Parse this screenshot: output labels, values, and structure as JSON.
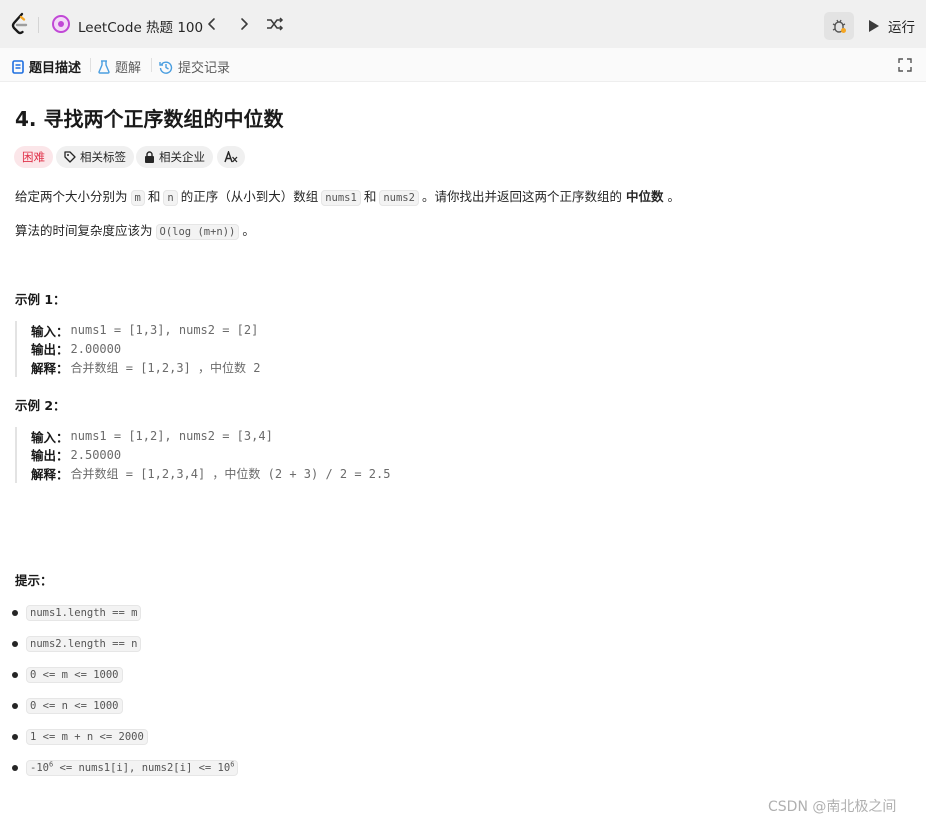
{
  "header": {
    "logo_icon": "leetcode-logo",
    "list_icon": "hot-list-icon",
    "list_title": "LeetCode 热题 100",
    "prev_icon": "chevron-left-icon",
    "next_icon": "chevron-right-icon",
    "shuffle_icon": "shuffle-icon",
    "debug_icon": "debug-icon",
    "run_label": "运行"
  },
  "tabs": [
    {
      "label": "题目描述",
      "icon": "description-icon",
      "active": true
    },
    {
      "label": "题解",
      "icon": "flask-icon",
      "active": false
    },
    {
      "label": "提交记录",
      "icon": "history-icon",
      "active": false
    }
  ],
  "problem": {
    "title": "4. 寻找两个正序数组的中位数",
    "tags": [
      {
        "label": "困难",
        "icon": ""
      },
      {
        "label": "相关标签",
        "icon": "tag-icon"
      },
      {
        "label": "相关企业",
        "icon": "lock-icon"
      },
      {
        "label": "",
        "icon": "translate-icon"
      }
    ],
    "desc": {
      "p1": "给定两个大小分别为",
      "c1": "m",
      "p2": "和",
      "c2": "n",
      "p3": "的正序（从小到大）数组",
      "c3": "nums1",
      "p4": "和",
      "c4": "nums2",
      "p5": "。请你找出并返回这两个正序数组的",
      "bold": "中位数",
      "p6": "。"
    },
    "complexity": {
      "text": "算法的时间复杂度应该为",
      "code": "O(log (m+n))",
      "end": "。"
    },
    "examples": [
      {
        "title": "示例 1：",
        "input_key": "输入：",
        "input": "nums1 = [1,3], nums2 = [2]",
        "output_key": "输出：",
        "output": "2.00000",
        "explain_key": "解释：",
        "explain": "合并数组 = [1,2,3] ，中位数 2"
      },
      {
        "title": "示例 2：",
        "input_key": "输入：",
        "input": "nums1 = [1,2], nums2 = [3,4]",
        "output_key": "输出：",
        "output": "2.50000",
        "explain_key": "解释：",
        "explain": "合并数组 = [1,2,3,4] ，中位数 (2 + 3) / 2 = 2.5"
      }
    ],
    "hints_title": "提示：",
    "hints": [
      "nums1.length == m",
      "nums2.length == n",
      "0 <= m <= 1000",
      "0 <= n <= 1000",
      "1 <= m + n <= 2000"
    ],
    "last_hint": {
      "a": "-10",
      "exp": "6",
      "b": " <= nums1[i], nums2[i] <= 10",
      "exp2": "6"
    }
  },
  "watermark": "CSDN @南北极之间"
}
